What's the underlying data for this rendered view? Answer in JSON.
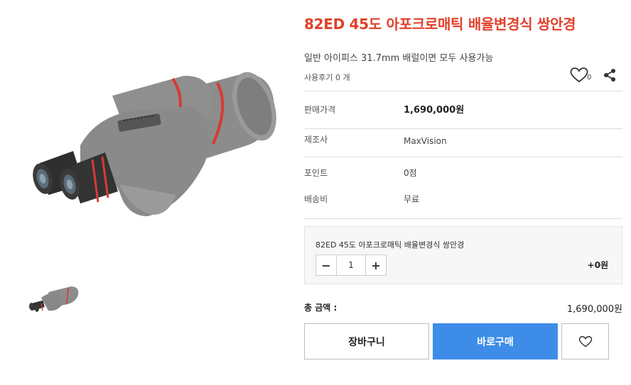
{
  "product": {
    "title": "82ED 45도 아포크로매틱 배율변경식 쌍안경",
    "subtitle": "일반 아이피스 31.7mm 배럴이면 모두 사용가능",
    "review_label": "사용후기 0 개",
    "wish_count": "0",
    "accent_color": "#e2402a"
  },
  "images": {
    "main_alt": "binoculars-main-image",
    "thumb_alt": "binoculars-thumbnail"
  },
  "specs": [
    {
      "label": "판매가격",
      "value": "1,690,000원"
    },
    {
      "label": "제조사",
      "value": "MaxVision"
    },
    {
      "label": "포인트",
      "value": "0점"
    },
    {
      "label": "배송비",
      "value": "무료"
    }
  ],
  "option": {
    "name": "82ED 45도 아포크로매틱 배율변경식 쌍안경",
    "minus": "−",
    "quantity": "1",
    "plus": "+",
    "price": "+0원"
  },
  "total": {
    "label": "총 금액 :",
    "value": "1,690,000원"
  },
  "actions": {
    "cart": "장바구니",
    "buy": "바로구매",
    "buy_color": "#3d8de8"
  },
  "icons": {
    "wish_top": "heart-outline-icon",
    "share": "share-icon",
    "wish_button": "heart-outline-icon"
  }
}
